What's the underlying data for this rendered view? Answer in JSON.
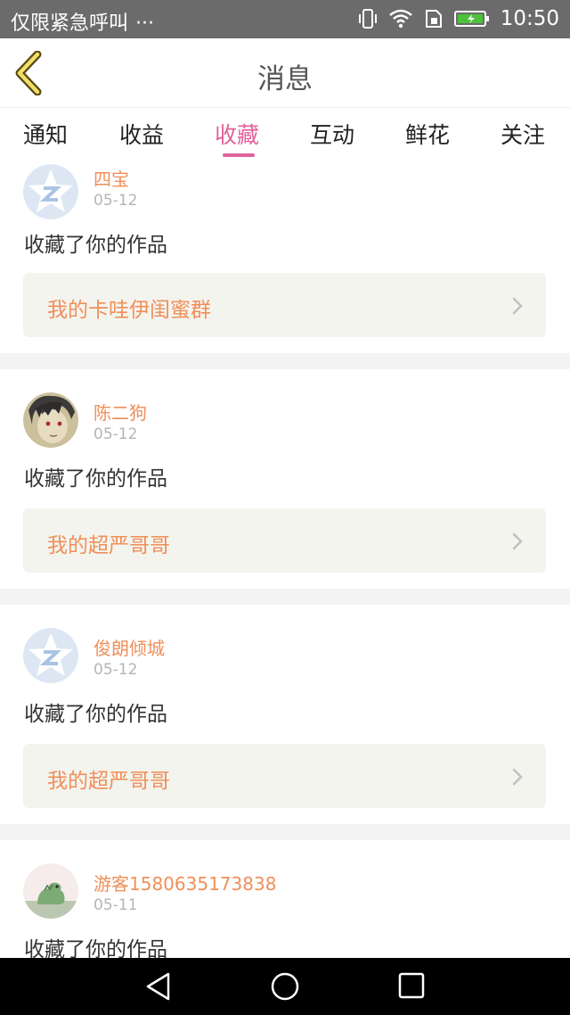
{
  "status_bar": {
    "carrier": "仅限紧急呼叫",
    "more": "···",
    "time": "10:50",
    "icons": [
      "vibrate-icon",
      "wifi-icon",
      "sim-icon",
      "battery-charging-icon"
    ]
  },
  "header": {
    "title": "消息",
    "back_icon": "chevron-left-icon"
  },
  "tabs": [
    {
      "label": "通知",
      "active": false
    },
    {
      "label": "收益",
      "active": false
    },
    {
      "label": "收藏",
      "active": true
    },
    {
      "label": "互动",
      "active": false
    },
    {
      "label": "鲜花",
      "active": false
    },
    {
      "label": "关注",
      "active": false
    }
  ],
  "feed": [
    {
      "name": "四宝",
      "date": "05-12",
      "action": "收藏了你的作品",
      "work": "我的卡哇伊闺蜜群",
      "avatar": "default-z-avatar"
    },
    {
      "name": "陈二狗",
      "date": "05-12",
      "action": "收藏了你的作品",
      "work": "我的超严哥哥",
      "avatar": "anime-character-avatar"
    },
    {
      "name": "俊朗倾城",
      "date": "05-12",
      "action": "收藏了你的作品",
      "work": "我的超严哥哥",
      "avatar": "default-z-avatar"
    },
    {
      "name": "游客1580635173838",
      "date": "05-11",
      "action": "收藏了你的作品",
      "work": "",
      "avatar": "green-dinosaur-avatar"
    }
  ],
  "nav_bar": {
    "icons": [
      "back-triangle-icon",
      "home-circle-icon",
      "recents-square-icon"
    ]
  },
  "colors": {
    "accent_pink": "#e0629a",
    "accent_orange": "#ef8f5a",
    "card_background": "#f4f4ee",
    "status_bar": "#6b6b6b"
  }
}
